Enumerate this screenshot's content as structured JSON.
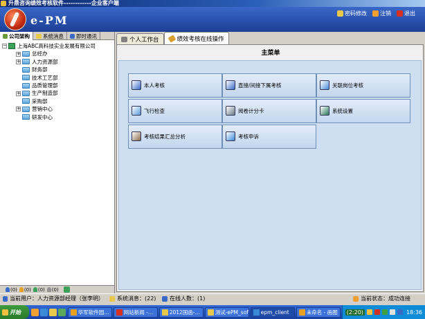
{
  "window": {
    "title": "升鼎咨询绩效考核软件------------企业客户端"
  },
  "header": {
    "logo_text": "e-PM",
    "links": [
      {
        "label": "密码修改",
        "icon": "key-icon"
      },
      {
        "label": "注销",
        "icon": "logout-icon"
      },
      {
        "label": "退出",
        "icon": "exit-icon"
      }
    ]
  },
  "left_panel": {
    "tabs": [
      {
        "label": "公司架构",
        "icon": "org-icon"
      },
      {
        "label": "系统消息",
        "icon": "message-icon"
      },
      {
        "label": "即时通讯",
        "icon": "chat-icon"
      }
    ],
    "tree_root": "上海ABC高科技实业发展有限公司",
    "tree": [
      {
        "label": "总经办",
        "expandable": true
      },
      {
        "label": "人力资源部",
        "expandable": true
      },
      {
        "label": "财务部",
        "expandable": false
      },
      {
        "label": "技术工艺部",
        "expandable": false
      },
      {
        "label": "品质管理部",
        "expandable": false
      },
      {
        "label": "生产制造部",
        "expandable": true
      },
      {
        "label": "采购部",
        "expandable": false
      },
      {
        "label": "营销中心",
        "expandable": true
      },
      {
        "label": "研发中心",
        "expandable": false
      }
    ],
    "footer_counts": [
      "(0)",
      "(0)",
      "(0)",
      "(0)"
    ]
  },
  "right_panel": {
    "tabs": [
      {
        "label": "个人工作台",
        "icon": "desk-icon"
      },
      {
        "label": "绩效考核在线操作",
        "icon": "pencil-icon"
      }
    ],
    "menu_title": "主菜单",
    "menu_items": [
      {
        "label": "本人考核",
        "icon": "self-review-icon"
      },
      {
        "label": "直接/间接下属考核",
        "icon": "subordinate-review-icon"
      },
      {
        "label": "关联岗位考核",
        "icon": "related-post-icon"
      },
      {
        "label": "飞行检查",
        "icon": "inspection-icon"
      },
      {
        "label": "阅卷计分卡",
        "icon": "scorecard-icon"
      },
      {
        "label": "系统设置",
        "icon": "settings-icon"
      },
      {
        "label": "考核结果汇总分析",
        "icon": "analysis-icon"
      },
      {
        "label": "考核申诉",
        "icon": "appeal-icon"
      }
    ]
  },
  "status_bar": {
    "current_user": "当前用户：人力资源部经理（张李明）",
    "system_messages": "系统消息：(22)",
    "online_count": "在线人数：(1)",
    "connection_status": "当前状态：成功连接"
  },
  "taskbar": {
    "start_label": "开始",
    "tasks": [
      {
        "label": "华军软件园..."
      },
      {
        "label": "网站新闻 -..."
      },
      {
        "label": "2012国函-..."
      },
      {
        "label": "测试-ePM_soft"
      },
      {
        "label": "epm_client"
      },
      {
        "label": "未命名 - 画图"
      }
    ],
    "im_indicator": "(2:20)",
    "clock": "18:36"
  }
}
